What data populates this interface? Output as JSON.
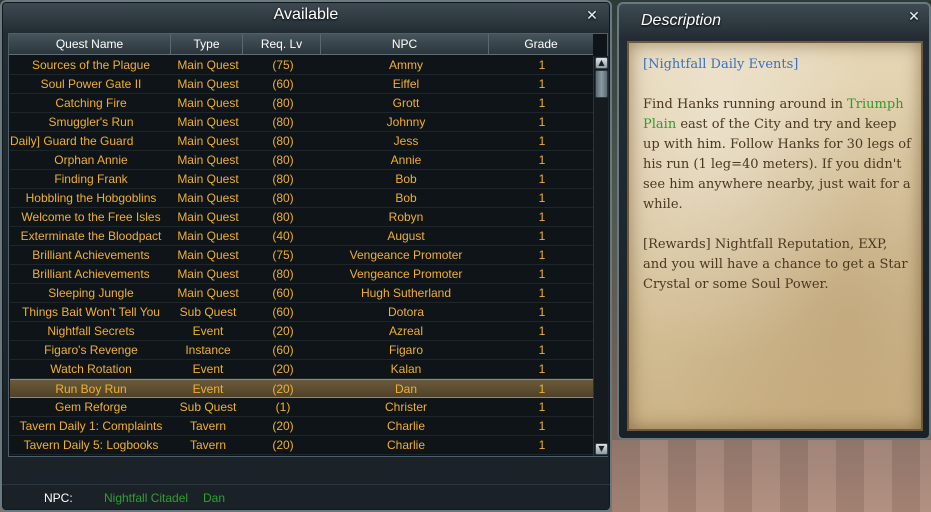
{
  "available_window": {
    "title": "Available",
    "close_label": "✕",
    "columns": [
      "Quest Name",
      "Type",
      "Req. Lv",
      "NPC",
      "Grade"
    ],
    "rows": [
      {
        "name": "Sources of the Plague",
        "type": "Main Quest",
        "lv": "(75)",
        "npc": "Ammy",
        "grade": "1"
      },
      {
        "name": "Soul Power Gate II",
        "type": "Main Quest",
        "lv": "(60)",
        "npc": "Eiffel",
        "grade": "1"
      },
      {
        "name": "Catching Fire",
        "type": "Main Quest",
        "lv": "(80)",
        "npc": "Grott",
        "grade": "1"
      },
      {
        "name": "Smuggler's Run",
        "type": "Main Quest",
        "lv": "(80)",
        "npc": "Johnny",
        "grade": "1"
      },
      {
        "name": "Daily] Guard the Guard",
        "type": "Main Quest",
        "lv": "(80)",
        "npc": "Jess",
        "grade": "1"
      },
      {
        "name": "Orphan Annie",
        "type": "Main Quest",
        "lv": "(80)",
        "npc": "Annie",
        "grade": "1"
      },
      {
        "name": "Finding Frank",
        "type": "Main Quest",
        "lv": "(80)",
        "npc": "Bob",
        "grade": "1"
      },
      {
        "name": "Hobbling the Hobgoblins",
        "type": "Main Quest",
        "lv": "(80)",
        "npc": "Bob",
        "grade": "1"
      },
      {
        "name": "Welcome to the Free Isles",
        "type": "Main Quest",
        "lv": "(80)",
        "npc": "Robyn",
        "grade": "1"
      },
      {
        "name": "Exterminate the Bloodpact",
        "type": "Main Quest",
        "lv": "(40)",
        "npc": "August",
        "grade": "1"
      },
      {
        "name": "Brilliant Achievements",
        "type": "Main Quest",
        "lv": "(75)",
        "npc": "Vengeance Promoter",
        "grade": "1"
      },
      {
        "name": "Brilliant Achievements",
        "type": "Main Quest",
        "lv": "(80)",
        "npc": "Vengeance Promoter",
        "grade": "1"
      },
      {
        "name": "Sleeping Jungle",
        "type": "Main Quest",
        "lv": "(60)",
        "npc": "Hugh Sutherland",
        "grade": "1"
      },
      {
        "name": "Things Bait Won't Tell You",
        "type": "Sub Quest",
        "lv": "(60)",
        "npc": "Dotora",
        "grade": "1"
      },
      {
        "name": "Nightfall Secrets",
        "type": "Event",
        "lv": "(20)",
        "npc": "Azreal",
        "grade": "1"
      },
      {
        "name": "Figaro's Revenge",
        "type": "Instance",
        "lv": "(60)",
        "npc": "Figaro",
        "grade": "1"
      },
      {
        "name": "Watch Rotation",
        "type": "Event",
        "lv": "(20)",
        "npc": "Kalan",
        "grade": "1"
      },
      {
        "name": "Run Boy Run",
        "type": "Event",
        "lv": "(20)",
        "npc": "Dan",
        "grade": "1"
      },
      {
        "name": "Gem Reforge",
        "type": "Sub Quest",
        "lv": "(1)",
        "npc": "Christer",
        "grade": "1"
      },
      {
        "name": "Tavern Daily 1: Complaints",
        "type": "Tavern",
        "lv": "(20)",
        "npc": "Charlie",
        "grade": "1"
      },
      {
        "name": "Tavern Daily 5: Logbooks",
        "type": "Tavern",
        "lv": "(20)",
        "npc": "Charlie",
        "grade": "1"
      }
    ],
    "selected_index": 17,
    "footer": {
      "label": "NPC:",
      "location": "Nightfall Citadel",
      "npc": "Dan"
    }
  },
  "description_window": {
    "title": "Description",
    "close_label": "✕",
    "heading": "[Nightfall Daily Events]",
    "body_before": "Find Hanks running around in ",
    "body_place": "Triumph Plain",
    "body_after": " east of the City and try and keep up with him. Follow Hanks for 30 legs of his run (1 leg=40 meters). If you didn't see him anywhere nearby, just wait for a while.",
    "rewards": "[Rewards] Nightfall Reputation, EXP, and you will have a chance to get a Star Crystal or some Soul Power."
  },
  "colors": {
    "row_text": "#f0b030",
    "npc_green": "#2ea030",
    "link_blue": "#3a6fc0"
  }
}
